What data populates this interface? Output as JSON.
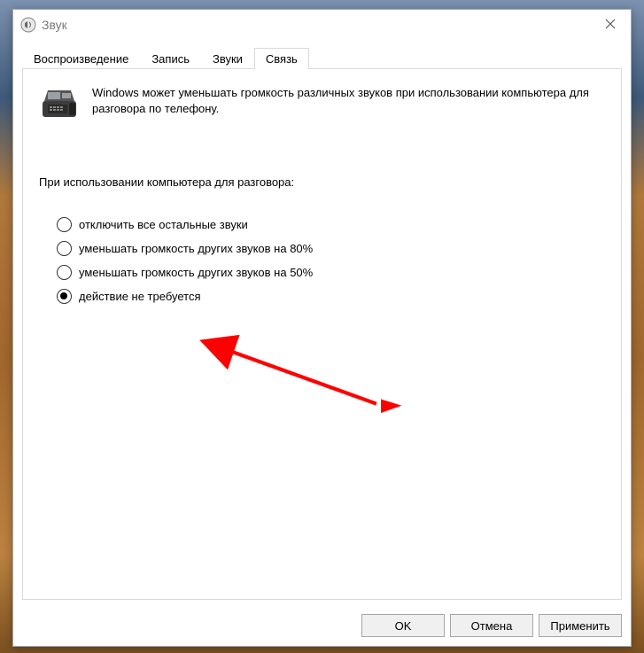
{
  "window": {
    "title": "Звук"
  },
  "tabs": [
    {
      "label": "Воспроизведение"
    },
    {
      "label": "Запись"
    },
    {
      "label": "Звуки"
    },
    {
      "label": "Связь"
    }
  ],
  "active_tab_index": 3,
  "info_text": "Windows может уменьшать громкость различных звуков при использовании компьютера для разговора по телефону.",
  "question": "При использовании компьютера для разговора:",
  "options": [
    {
      "label": "отключить все остальные звуки",
      "checked": false
    },
    {
      "label": "уменьшать громкость других звуков на 80%",
      "checked": false
    },
    {
      "label": "уменьшать громкость других звуков на 50%",
      "checked": false
    },
    {
      "label": "действие не требуется",
      "checked": true
    }
  ],
  "buttons": {
    "ok": "OK",
    "cancel": "Отмена",
    "apply": "Применить"
  }
}
